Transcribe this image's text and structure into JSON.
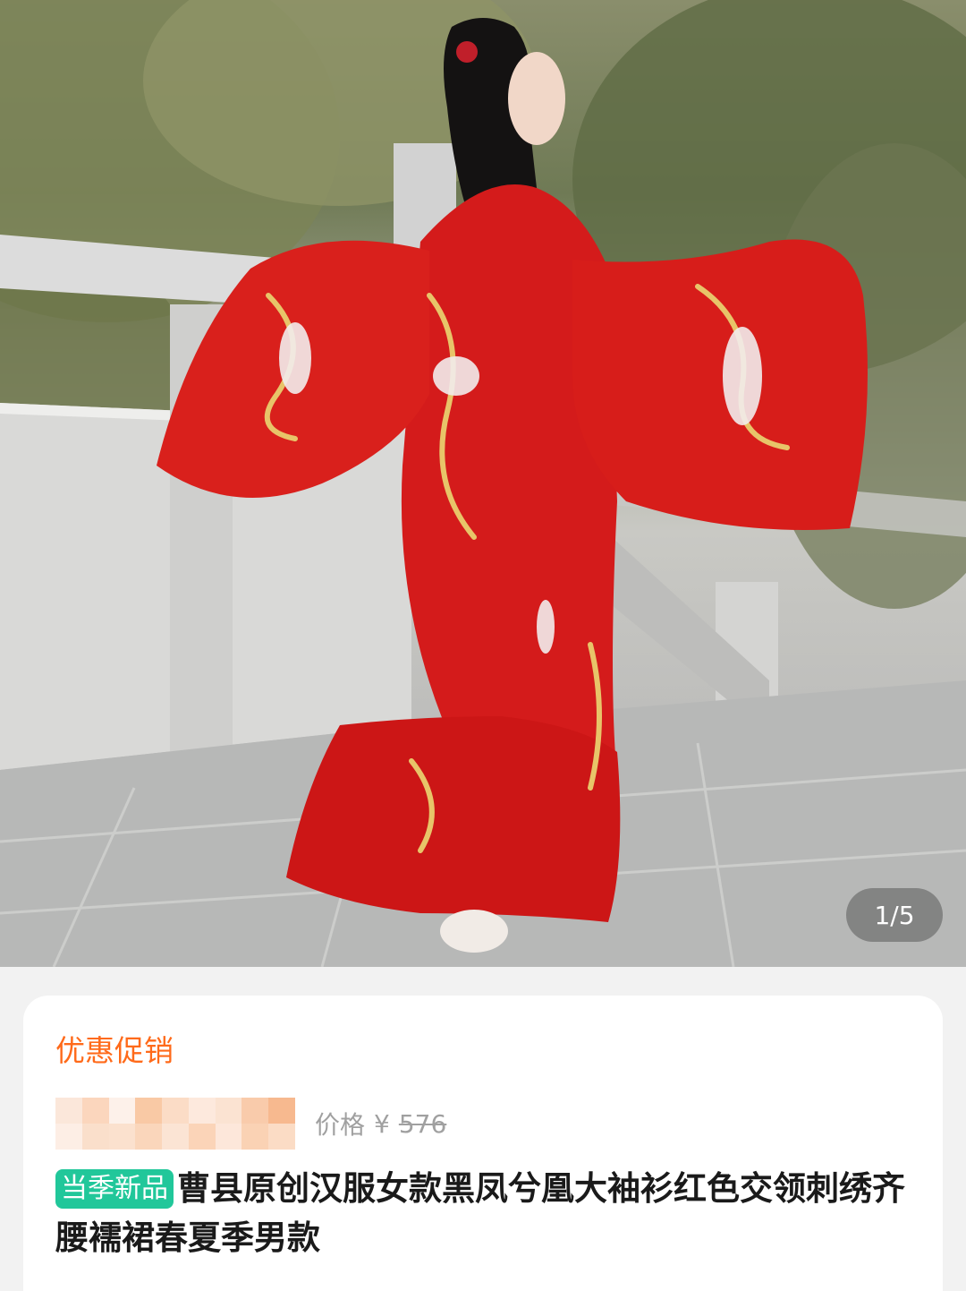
{
  "carousel": {
    "counter": "1/5",
    "image_description_icon": "product-photo"
  },
  "card": {
    "promo_label": "优惠促销",
    "price_label": "价格",
    "currency": "¥",
    "original_price": "576",
    "badge": "当季新品",
    "title": "曹县原创汉服女款黑凤兮凰大袖衫红色交领刺绣齐腰襦裙春夏季男款"
  },
  "colors": {
    "promo": "#ff6a1a",
    "badge_bg": "#21c79a",
    "dress_red": "#d21a1a",
    "embroidery_gold": "#e8c469"
  }
}
